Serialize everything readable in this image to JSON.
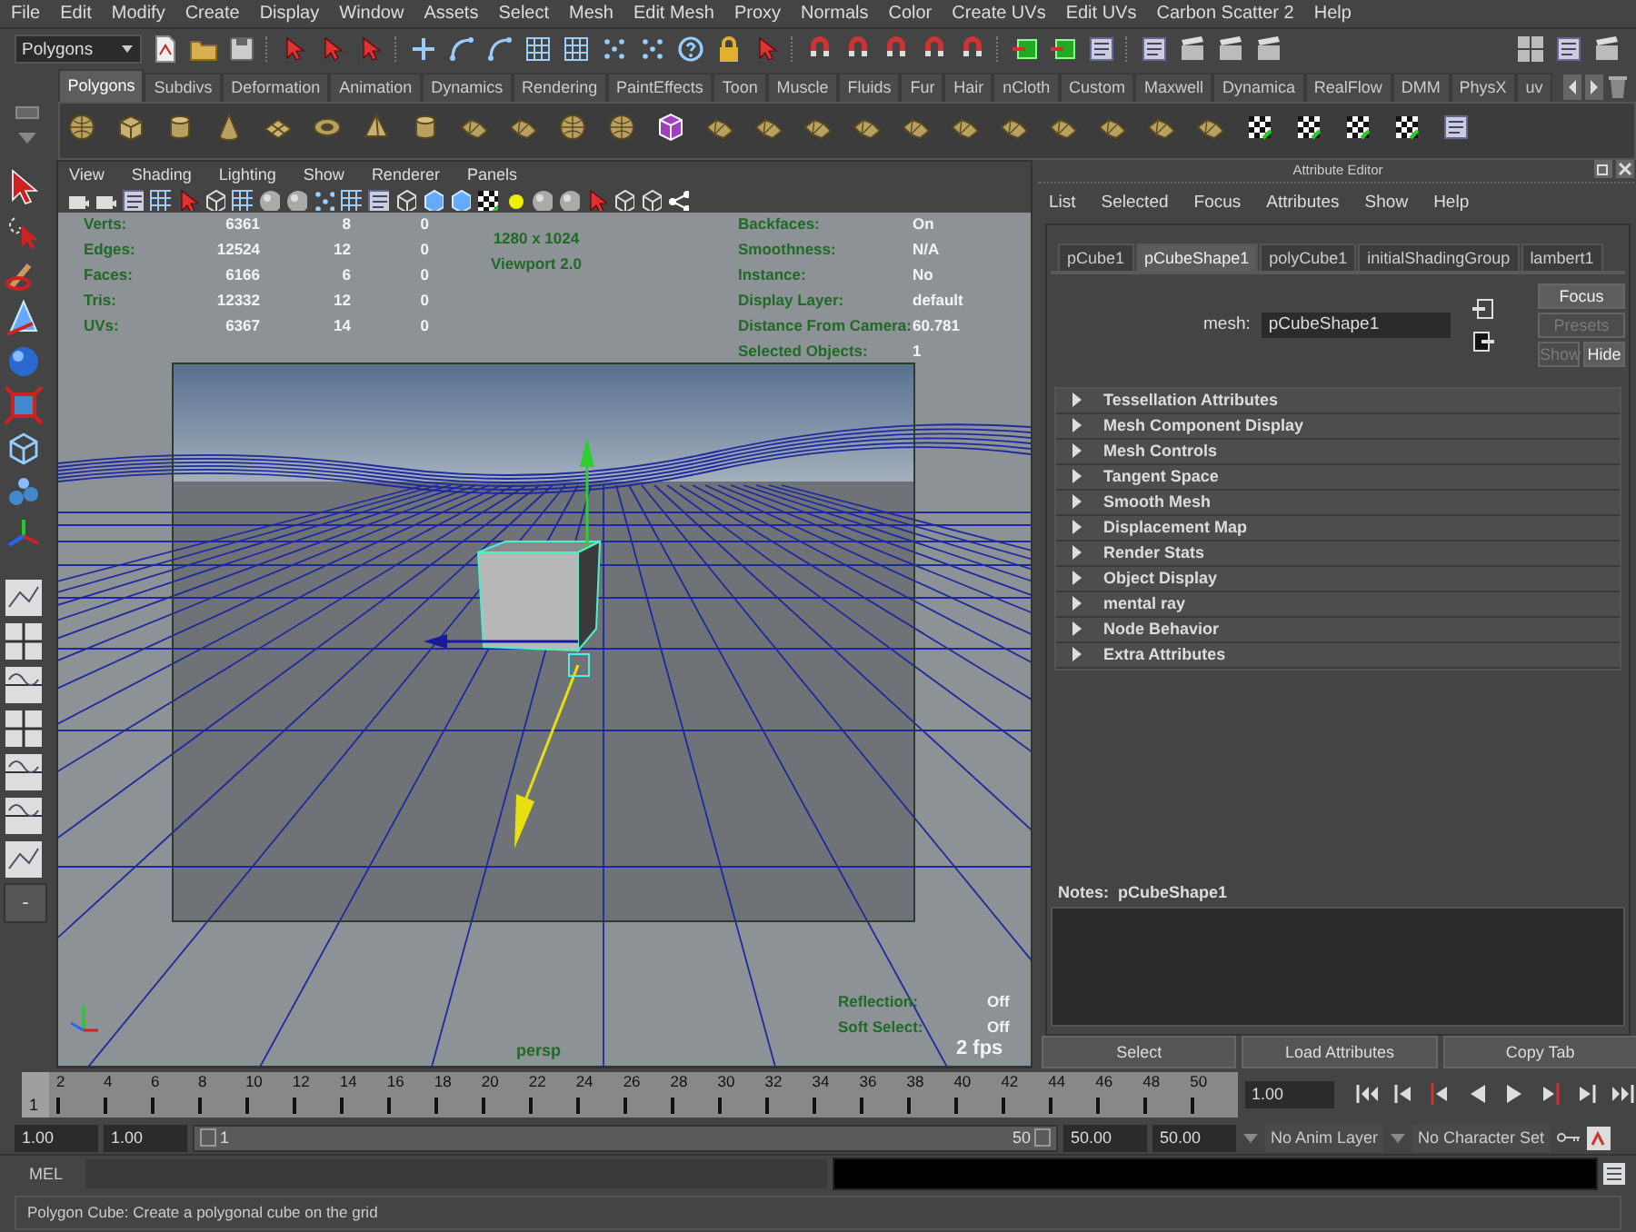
{
  "menubar": [
    "File",
    "Edit",
    "Modify",
    "Create",
    "Display",
    "Window",
    "Assets",
    "Select",
    "Mesh",
    "Edit Mesh",
    "Proxy",
    "Normals",
    "Color",
    "Create UVs",
    "Edit UVs",
    "Carbon Scatter 2",
    "Help"
  ],
  "status_line": {
    "mode_menu": "Polygons"
  },
  "shelf": {
    "tabs": [
      {
        "label": "Polygons",
        "selected": true
      },
      {
        "label": "Subdivs",
        "selected": false
      },
      {
        "label": "Deformation",
        "selected": false
      },
      {
        "label": "Animation",
        "selected": false
      },
      {
        "label": "Dynamics",
        "selected": false
      },
      {
        "label": "Rendering",
        "selected": false
      },
      {
        "label": "PaintEffects",
        "selected": false
      },
      {
        "label": "Toon",
        "selected": false
      },
      {
        "label": "Muscle",
        "selected": false
      },
      {
        "label": "Fluids",
        "selected": false
      },
      {
        "label": "Fur",
        "selected": false
      },
      {
        "label": "Hair",
        "selected": false
      },
      {
        "label": "nCloth",
        "selected": false
      },
      {
        "label": "Custom",
        "selected": false
      },
      {
        "label": "Maxwell",
        "selected": false
      },
      {
        "label": "Dynamica",
        "selected": false
      },
      {
        "label": "RealFlow",
        "selected": false
      },
      {
        "label": "DMM",
        "selected": false
      },
      {
        "label": "PhysX",
        "selected": false
      },
      {
        "label": "uv",
        "selected": false
      }
    ]
  },
  "toolbox": {
    "button": "-"
  },
  "viewport": {
    "menus": [
      "View",
      "Shading",
      "Lighting",
      "Show",
      "Renderer",
      "Panels"
    ],
    "hud_left": [
      {
        "label": "Verts:",
        "values": [
          "6361",
          "8",
          "0"
        ]
      },
      {
        "label": "Edges:",
        "values": [
          "12524",
          "12",
          "0"
        ]
      },
      {
        "label": "Faces:",
        "values": [
          "6166",
          "6",
          "0"
        ]
      },
      {
        "label": "Tris:",
        "values": [
          "12332",
          "12",
          "0"
        ]
      },
      {
        "label": "UVs:",
        "values": [
          "6367",
          "14",
          "0"
        ]
      }
    ],
    "hud_center": [
      "1280 x 1024",
      "Viewport 2.0"
    ],
    "hud_right": [
      {
        "label": "Backfaces:",
        "value": "On"
      },
      {
        "label": "Smoothness:",
        "value": "N/A"
      },
      {
        "label": "Instance:",
        "value": "No"
      },
      {
        "label": "Display Layer:",
        "value": "default"
      },
      {
        "label": "Distance From Camera:",
        "value": "60.781"
      },
      {
        "label": "Selected Objects:",
        "value": "1"
      }
    ],
    "hud_bottom": [
      {
        "label": "Reflection:",
        "value": "Off"
      },
      {
        "label": "Soft Select:",
        "value": "Off"
      }
    ],
    "fps": "2 fps",
    "camera": "persp"
  },
  "attribute_editor": {
    "title": "Attribute Editor",
    "menus": [
      "List",
      "Selected",
      "Focus",
      "Attributes",
      "Show",
      "Help"
    ],
    "tabs": [
      {
        "label": "pCube1",
        "selected": false
      },
      {
        "label": "pCubeShape1",
        "selected": true
      },
      {
        "label": "polyCube1",
        "selected": false
      },
      {
        "label": "initialShadingGroup",
        "selected": false
      },
      {
        "label": "lambert1",
        "selected": false
      }
    ],
    "mesh": {
      "label": "mesh:",
      "value": "pCubeShape1"
    },
    "buttons": [
      {
        "label": "Focus",
        "disabled": false
      },
      {
        "label": "Presets",
        "disabled": true
      },
      {
        "label": "Show",
        "disabled": true
      },
      {
        "label": "Hide",
        "disabled": false
      }
    ],
    "sections": [
      {
        "label": "Tessellation Attributes",
        "expanded": false
      },
      {
        "label": "Mesh Component Display",
        "expanded": false
      },
      {
        "label": "Mesh Controls",
        "expanded": false
      },
      {
        "label": "Tangent Space",
        "expanded": false
      },
      {
        "label": "Smooth Mesh",
        "expanded": false
      },
      {
        "label": "Displacement Map",
        "expanded": false
      },
      {
        "label": "Render Stats",
        "expanded": false
      },
      {
        "label": "Object Display",
        "expanded": false
      },
      {
        "label": "mental ray",
        "expanded": false
      },
      {
        "label": "Node Behavior",
        "expanded": false
      },
      {
        "label": "Extra Attributes",
        "expanded": false
      }
    ],
    "notes_label": "Notes:  pCubeShape1",
    "footer_buttons": [
      "Select",
      "Load Attributes",
      "Copy Tab"
    ]
  },
  "timeline": {
    "level": 0,
    "start": "1",
    "ticks": [
      "2",
      "4",
      "6",
      "8",
      "10",
      "12",
      "14",
      "16",
      "18",
      "20",
      "22",
      "24",
      "26",
      "28",
      "30",
      "32",
      "34",
      "36",
      "38",
      "40",
      "42",
      "44",
      "46",
      "48",
      "50"
    ],
    "current": "1.00"
  },
  "range": {
    "level": 1,
    "start": "1.00",
    "inner_start": "1.00",
    "slider_start": "1",
    "slider_end": "50",
    "inner_end": "50.00",
    "end": "50.00",
    "anim_layer": "No Anim Layer",
    "character_set": "No Character Set"
  },
  "command_line": {
    "label": "MEL"
  },
  "help_line": "Polygon Cube: Create a polygonal cube on the grid"
}
